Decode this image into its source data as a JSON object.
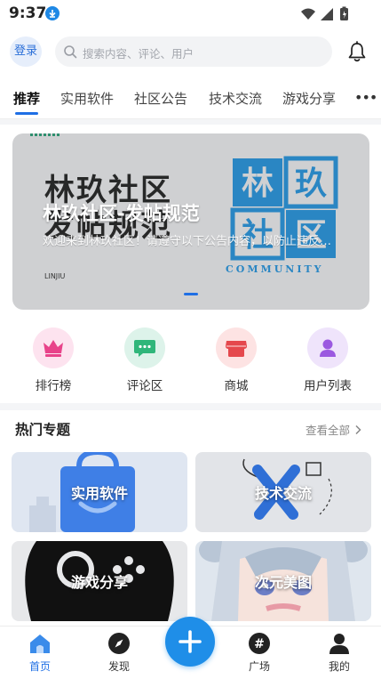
{
  "status_bar": {
    "time": "9:37"
  },
  "header": {
    "login_label": "登录",
    "search_placeholder": "搜索内容、评论、用户"
  },
  "tabs": [
    {
      "label": "推荐",
      "active": true
    },
    {
      "label": "实用软件",
      "active": false
    },
    {
      "label": "社区公告",
      "active": false
    },
    {
      "label": "技术交流",
      "active": false
    },
    {
      "label": "游戏分享",
      "active": false
    }
  ],
  "banner": {
    "title": "林玖社区-发帖规范",
    "subtitle": "欢迎来到林玖社区！请遵守以下公告内容，以防止违反社区规范",
    "background_text_line1": "林玖社区",
    "background_text_line2": "发帖规范",
    "logo_chars": [
      "林",
      "玖",
      "社",
      "区"
    ],
    "community_word": "COMMUNITY",
    "small_text": "LINJIU",
    "slide_index": 1
  },
  "quick_actions": [
    {
      "label": "排行榜",
      "icon": "crown-icon",
      "bg": "#fde3ef",
      "fg": "#e8438a"
    },
    {
      "label": "评论区",
      "icon": "comment-icon",
      "bg": "#ddf3ea",
      "fg": "#2fb67a"
    },
    {
      "label": "商城",
      "icon": "store-icon",
      "bg": "#fde3e3",
      "fg": "#e5484d"
    },
    {
      "label": "用户列表",
      "icon": "user-icon",
      "bg": "#efe4fb",
      "fg": "#9b59e0"
    }
  ],
  "hot_topics": {
    "title": "热门专题",
    "see_all": "查看全部",
    "cards": [
      {
        "label": "实用软件"
      },
      {
        "label": "技术交流"
      },
      {
        "label": "游戏分享"
      },
      {
        "label": "次元美图"
      }
    ]
  },
  "bottom_nav": [
    {
      "label": "首页",
      "icon": "home-icon",
      "active": true
    },
    {
      "label": "发现",
      "icon": "compass-icon",
      "active": false
    },
    {
      "label": "广场",
      "icon": "hashtag-icon",
      "active": false
    },
    {
      "label": "我的",
      "icon": "profile-icon",
      "active": false
    }
  ],
  "colors": {
    "accent": "#1f6fe5",
    "fab": "#1f8ee8"
  }
}
